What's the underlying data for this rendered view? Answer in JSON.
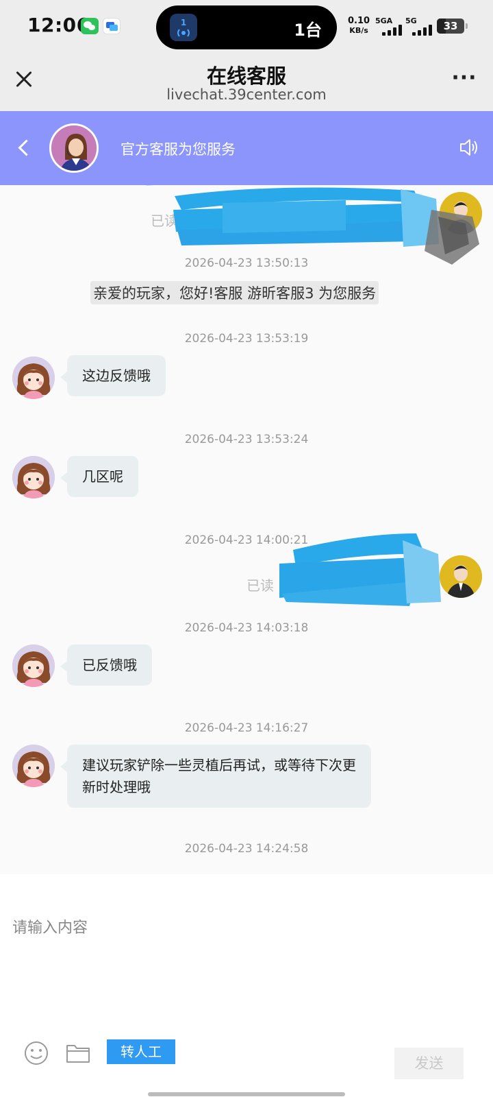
{
  "status_bar": {
    "time": "12:06",
    "island_badge": "1",
    "island_text": "1台",
    "net_speed_value": "0.10",
    "net_speed_unit": "KB/s",
    "signal_1_label": "5GA",
    "signal_2_label": "5G",
    "battery": "33"
  },
  "browser": {
    "title": "在线客服",
    "url": "livechat.39center.com"
  },
  "chat_header": {
    "title": "官方客服为您服务"
  },
  "messages": {
    "read_label_top": "已读",
    "ts1": "2026-04-23 13:50:13",
    "system_greeting": "亲爱的玩家，您好!客服 游昕客服3 为您服务",
    "ts2": "2026-04-23 13:53:19",
    "msg1": "这边反馈哦",
    "ts3": "2026-04-23 13:53:24",
    "msg2": "几区呢",
    "ts4": "2026-04-23 14:00:21",
    "read_label": "已读",
    "ts5": "2026-04-23 14:03:18",
    "msg3": "已反馈哦",
    "ts6": "2026-04-23 14:16:27",
    "msg4": "建议玩家铲除一些灵植后再试，或等待下次更新时处理哦",
    "ts7": "2026-04-23 14:24:58"
  },
  "input": {
    "placeholder": "请输入内容",
    "transfer_label": "转人工",
    "send_label": "发送"
  },
  "colors": {
    "header_bg": "#8b95fb",
    "bubble_bg": "#e9eff0",
    "transfer_bg": "#2f9af2",
    "scribble": "#29a8ea"
  }
}
